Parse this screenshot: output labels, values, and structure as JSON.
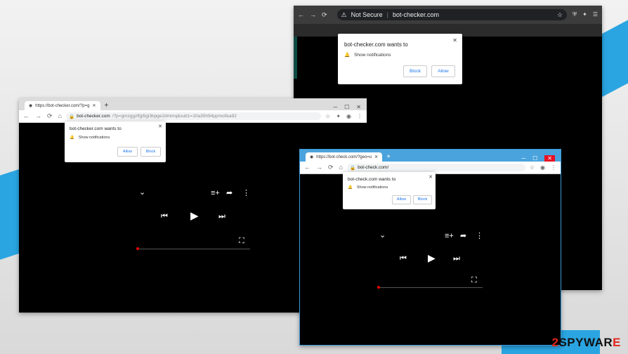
{
  "windows": {
    "top_right": {
      "security_label": "Not Secure",
      "url": "bot-checker.com",
      "popup": {
        "title": "bot-checker.com wants to",
        "item": "Show notifications",
        "block": "Block",
        "allow": "Allow"
      }
    },
    "left": {
      "tab_title": "https://bot-checker.com/?p=g",
      "url_host": "bot-checker.com",
      "url_path": "/?p=gmzggzlfgi5gi3bpge2dmmq&sub1=10a35h94ppmcifea92",
      "popup": {
        "title": "bot-checker.com wants to",
        "item": "Show notifications",
        "allow": "Allow",
        "block": "Block"
      }
    },
    "bottom_right": {
      "tab_title": "https://bot-check.com/?geo=u",
      "url": "bot-check.com/",
      "popup": {
        "title": "bot-check.com wants to",
        "item": "Show notifications",
        "allow": "Allow",
        "block": "Block"
      }
    }
  },
  "logo": {
    "prefix": "2",
    "brand": "SPYWAR",
    "suffix": "E"
  },
  "colors": {
    "accent_blue": "#2aa5e1",
    "progress_red": "#ee0000",
    "link_blue": "#1a73e8"
  },
  "video": {
    "progress_fraction": 0.0
  }
}
